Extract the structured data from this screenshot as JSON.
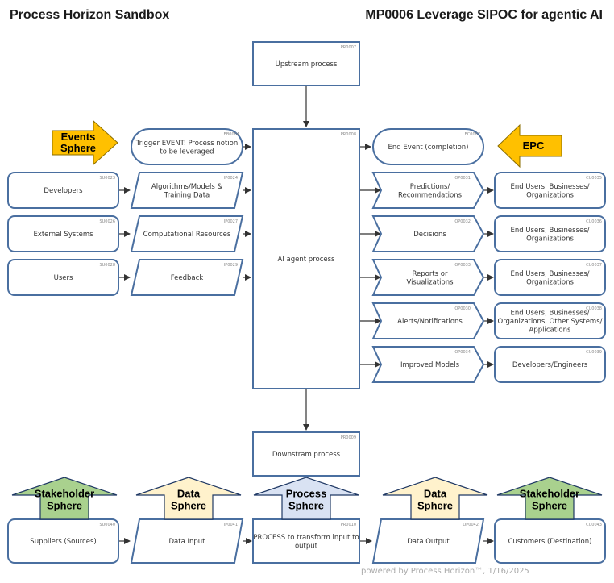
{
  "header": {
    "app_title": "Process Horizon Sandbox",
    "map_title": "MP0006 Leverage SIPOC for agentic AI"
  },
  "colors": {
    "node_border": "#4a6fa0",
    "events_arrow": "#ffc000",
    "stakeholder_arrow": "#a9d18e",
    "data_arrow": "#fff2cc",
    "process_arrow": "#d9e2f3",
    "connector": "#333333"
  },
  "nodes": {
    "upstream": {
      "id": "PR0007",
      "label": "Upstream process"
    },
    "trigger": {
      "id": "EB0004",
      "label": "Trigger EVENT: Process notion to be leveraged"
    },
    "agent": {
      "id": "PR0008",
      "label": "AI agent process"
    },
    "end_event": {
      "id": "EC0007",
      "label": "End Event (completion)"
    },
    "downstream": {
      "id": "PR0009",
      "label": "Downstram process"
    },
    "suppliers": [
      {
        "id": "SU0023",
        "label": "Developers"
      },
      {
        "id": "SU0026",
        "label": "External Systems"
      },
      {
        "id": "SU0028",
        "label": "Users"
      }
    ],
    "inputs": [
      {
        "id": "IP0024",
        "label": "Algorithms/Models & Training Data"
      },
      {
        "id": "IP0027",
        "label": "Computational Resources"
      },
      {
        "id": "IP0029",
        "label": "Feedback"
      }
    ],
    "outputs": [
      {
        "id": "OP0031",
        "label": "Predictions/ Recommendations"
      },
      {
        "id": "OP0032",
        "label": "Decisions"
      },
      {
        "id": "OP0033",
        "label": "Reports or Visualizations"
      },
      {
        "id": "OP0030",
        "label": "Alerts/Notifications"
      },
      {
        "id": "OP0034",
        "label": "Improved Models"
      }
    ],
    "customers": [
      {
        "id": "CU0035",
        "label": "End Users, Businesses/ Organizations"
      },
      {
        "id": "CU0036",
        "label": "End Users, Businesses/ Organizations"
      },
      {
        "id": "CU0037",
        "label": "End Users, Businesses/ Organizations"
      },
      {
        "id": "CU0038",
        "label": "End Users, Businesses/ Organizations, Other Systems/ Applications"
      },
      {
        "id": "CU0039",
        "label": "Developers/Engineers"
      }
    ],
    "legend_row": [
      {
        "id": "SU0040",
        "label": "Suppliers (Sources)",
        "shape": "rounded"
      },
      {
        "id": "IP0041",
        "label": "Data Input",
        "shape": "parallelogram"
      },
      {
        "id": "PR0010",
        "label": "PROCESS to transform input to output",
        "shape": "rect"
      },
      {
        "id": "OP0042",
        "label": "Data Output",
        "shape": "parallelogram"
      },
      {
        "id": "CU0043",
        "label": "Customers (Destination)",
        "shape": "rounded"
      }
    ]
  },
  "spheres": {
    "events": {
      "label": "Events Sphere",
      "direction": "right"
    },
    "epc": {
      "label": "EPC",
      "direction": "left"
    },
    "bottom": [
      {
        "label": "Stakeholder Sphere",
        "kind": "stakeholder"
      },
      {
        "label": "Data Sphere",
        "kind": "data"
      },
      {
        "label": "Process Sphere",
        "kind": "process"
      },
      {
        "label": "Data Sphere",
        "kind": "data"
      },
      {
        "label": "Stakeholder Sphere",
        "kind": "stakeholder"
      }
    ]
  },
  "footer": {
    "text": "powered by Process Horizon™, 1/16/2025"
  }
}
